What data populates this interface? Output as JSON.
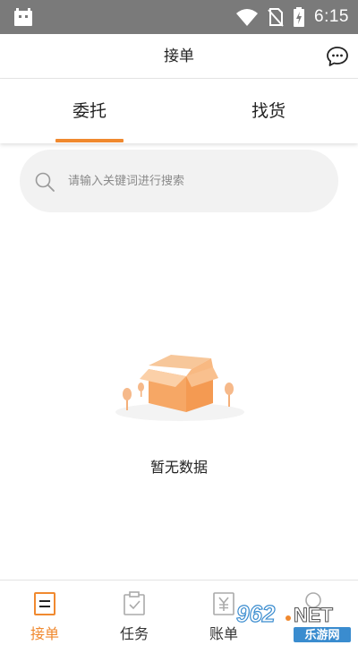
{
  "status_bar": {
    "time": "6:15"
  },
  "header": {
    "title": "接单",
    "chat_icon": "chat-bubble-icon"
  },
  "tabs": [
    {
      "label": "委托",
      "active": true
    },
    {
      "label": "找货",
      "active": false
    }
  ],
  "search": {
    "placeholder": "请输入关键词进行搜索",
    "value": ""
  },
  "empty_state": {
    "text": "暂无数据",
    "icon": "empty-box-icon"
  },
  "bottom_nav": [
    {
      "label": "接单",
      "icon": "order-list-icon",
      "active": true
    },
    {
      "label": "任务",
      "icon": "task-clipboard-icon",
      "active": false
    },
    {
      "label": "账单",
      "icon": "bill-yen-icon",
      "active": false
    },
    {
      "label": "",
      "icon": "profile-icon",
      "active": false
    }
  ],
  "watermark": {
    "logo_text": "962.NET",
    "sub_text": "乐游网"
  },
  "colors": {
    "accent": "#f0892f",
    "status_bar": "#7a7a7a",
    "search_bg": "#f2f2f2"
  }
}
